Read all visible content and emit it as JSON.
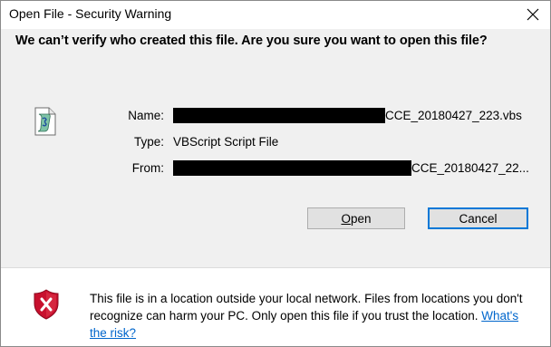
{
  "window": {
    "title": "Open File - Security Warning"
  },
  "dialog": {
    "headline": "We can’t verify who created this file. Are you sure you want to open this file?",
    "fields": {
      "name_label": "Name:",
      "name_value": "CCE_20180427_223.vbs",
      "type_label": "Type:",
      "type_value": "VBScript Script File",
      "from_label": "From:",
      "from_value": "CCE_20180427_22..."
    },
    "buttons": {
      "open_accel": "O",
      "open_rest": "pen",
      "cancel_label": "Cancel"
    }
  },
  "footer": {
    "warning_text": "This file is in a location outside your local network. Files from locations you don't recognize can harm your PC. Only open this file if you trust the location.",
    "risk_link": "What's the risk?"
  },
  "icons": {
    "file": "vbscript-file-icon",
    "shield": "security-shield-icon",
    "close": "close-icon"
  },
  "colors": {
    "link": "#0066cc",
    "shield": "#c8102e",
    "default_button_border": "#0078d7"
  }
}
